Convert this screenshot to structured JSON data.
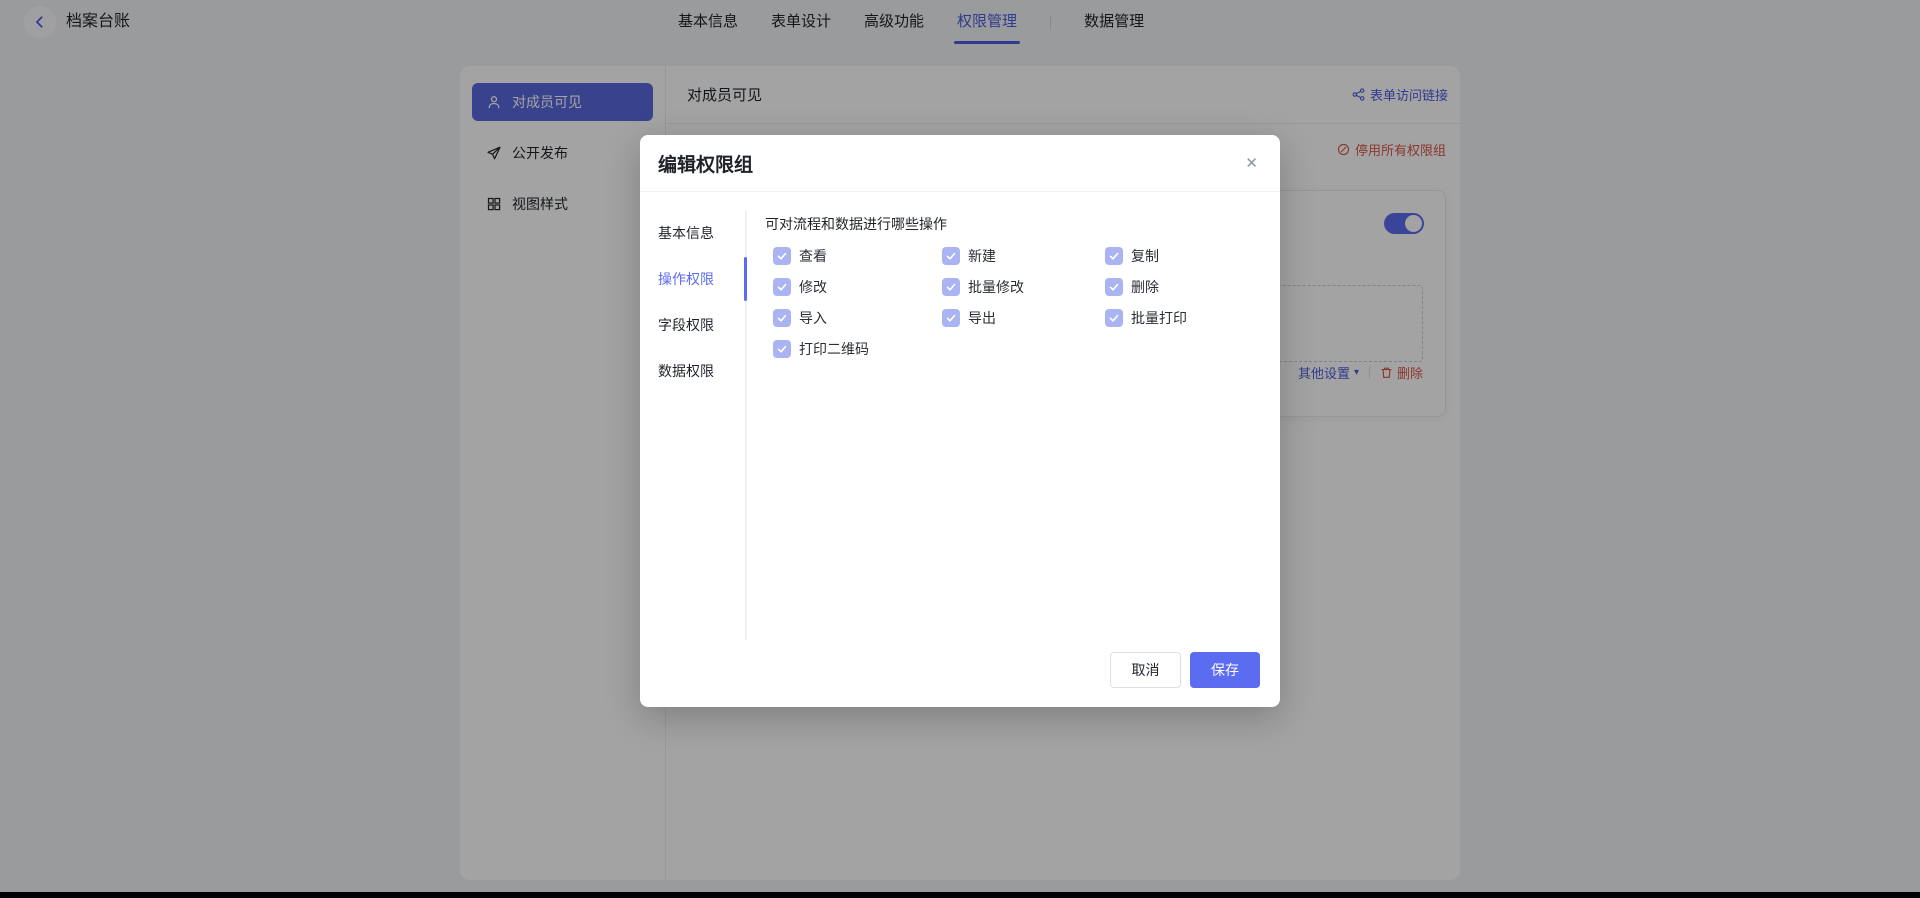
{
  "colors": {
    "accent": "#5B6CF0",
    "nav_active": "#4C5CE0",
    "sidebar_selected_bg": "#5A68DB",
    "danger": "#D9574A",
    "checkbox_checked": "#ABB4F2",
    "page_bg": "#F0F2F5"
  },
  "topbar": {
    "title": "档案台账",
    "tabs": [
      {
        "label": "基本信息"
      },
      {
        "label": "表单设计"
      },
      {
        "label": "高级功能"
      },
      {
        "label": "权限管理",
        "active": true
      },
      {
        "label": "数据管理"
      }
    ]
  },
  "sidebar": {
    "items": [
      {
        "label": "对成员可见",
        "icon": "person-icon",
        "selected": true
      },
      {
        "label": "公开发布",
        "icon": "paper-plane-icon",
        "selected": false
      },
      {
        "label": "视图样式",
        "icon": "grid-icon",
        "selected": false
      }
    ]
  },
  "main": {
    "title": "对成员可见",
    "form_access_link": "表单访问链接",
    "disable_all_groups": "停用所有权限组",
    "other_settings": "其他设置",
    "caret_glyph": "▾",
    "delete": "删除",
    "toggle_on": true
  },
  "modal": {
    "title": "编辑权限组",
    "close_glyph": "✕",
    "tabs": [
      {
        "label": "基本信息",
        "active": false
      },
      {
        "label": "操作权限",
        "active": true
      },
      {
        "label": "字段权限",
        "active": false
      },
      {
        "label": "数据权限",
        "active": false
      }
    ],
    "section_title": "可对流程和数据进行哪些操作",
    "permissions": [
      {
        "label": "查看",
        "checked": true
      },
      {
        "label": "新建",
        "checked": true
      },
      {
        "label": "复制",
        "checked": true
      },
      {
        "label": "修改",
        "checked": true
      },
      {
        "label": "批量修改",
        "checked": true
      },
      {
        "label": "删除",
        "checked": true
      },
      {
        "label": "导入",
        "checked": true
      },
      {
        "label": "导出",
        "checked": true
      },
      {
        "label": "批量打印",
        "checked": true
      },
      {
        "label": "打印二维码",
        "checked": true
      }
    ],
    "cancel": "取消",
    "save": "保存"
  }
}
